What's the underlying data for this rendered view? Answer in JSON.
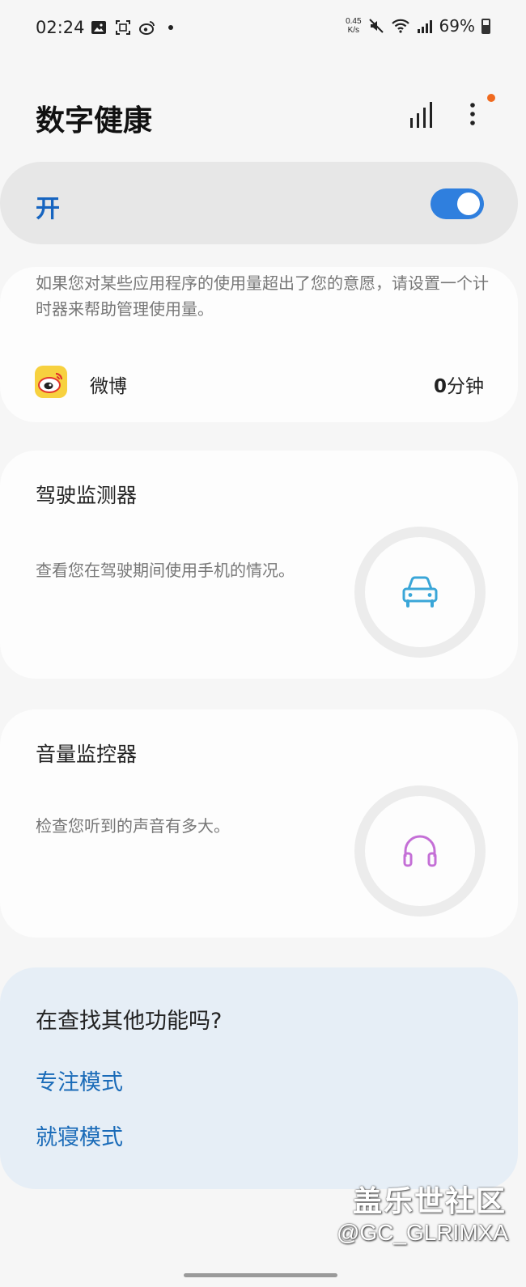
{
  "status_bar": {
    "time": "02:24",
    "speed_value": "0.45",
    "speed_unit": "K/s",
    "battery": "69%"
  },
  "header": {
    "title": "数字健康"
  },
  "master_toggle": {
    "label": "开",
    "state": "on"
  },
  "app_timer": {
    "description": "如果您对某些应用程序的使用量超出了您的意愿，请设置一个计时器来帮助管理使用量。",
    "apps": [
      {
        "name": "微博",
        "usage_value": "0",
        "usage_unit": "分钟"
      }
    ]
  },
  "driving_monitor": {
    "title": "驾驶监测器",
    "description": "查看您在驾驶期间使用手机的情况。"
  },
  "volume_monitor": {
    "title": "音量监控器",
    "description": "检查您听到的声音有多大。"
  },
  "more_features": {
    "title": "在查找其他功能吗?",
    "links": [
      "专注模式",
      "就寝模式"
    ]
  },
  "watermark": {
    "line1": "盖乐世社区",
    "line2": "@GC_GLRIMXA"
  },
  "colors": {
    "accent": "#2f7fde",
    "link": "#1a6bb8",
    "car_icon": "#3aa6d8",
    "headphone_icon": "#c46fd6",
    "notification_dot": "#f06a1f"
  }
}
